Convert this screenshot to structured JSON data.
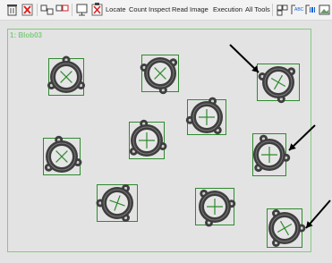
{
  "toolbar": {
    "icons": [
      "trash-icon",
      "delete-all-icon",
      "group-icon",
      "ungroup-icon",
      "layout-icon",
      "clear-icon"
    ],
    "menus": [
      "Locate",
      "Count",
      "Inspect",
      "Read",
      "Image",
      "Execution",
      "All Tools"
    ],
    "right_icons": [
      "grid-icon",
      "abc-text-icon",
      "barcode-icon",
      "image-icon"
    ]
  },
  "viewport": {
    "roi_label": "1: Blob03",
    "detected_parts": 10,
    "highlighted_parts": 4
  },
  "colors": {
    "overlay_green": "#2f8a2f",
    "roi_green": "#7fcc7f",
    "part_dark": "#3e3e3e",
    "background": "#e3e3e3",
    "arrow": "#000000"
  }
}
